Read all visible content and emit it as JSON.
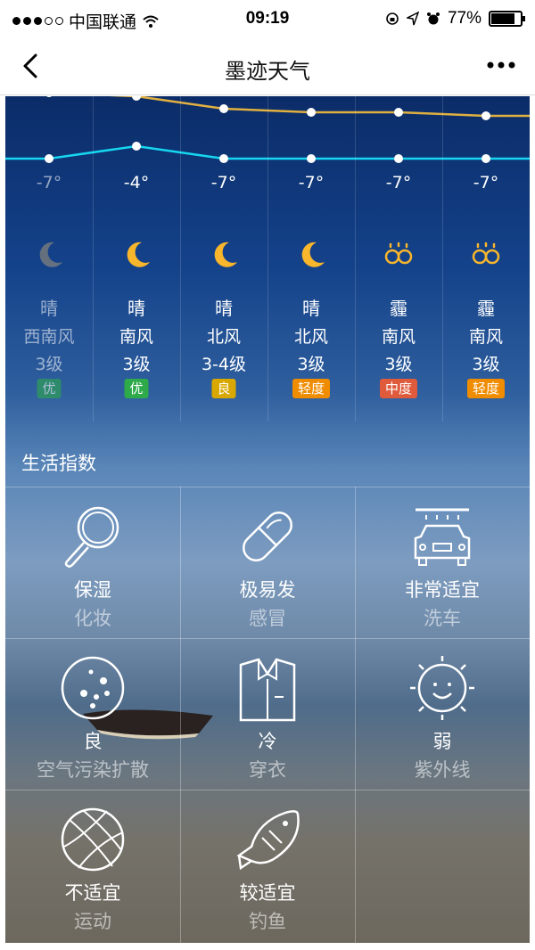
{
  "status_bar": {
    "carrier": "中国联通",
    "time": "09:19",
    "battery": "77%",
    "signal_bars_filled": 3,
    "signal_bars_total": 5
  },
  "nav": {
    "title": "墨迹天气",
    "back_icon": "chevron-left-icon",
    "more_icon": "more-dots-icon"
  },
  "forecast": {
    "days": [
      {
        "low": "-7°",
        "cond": "晴",
        "wind": "西南风",
        "level": "3级",
        "aqi": "优",
        "aqi_color": "#2eaa4a",
        "icon": "moon-icon",
        "dim": true
      },
      {
        "low": "-4°",
        "cond": "晴",
        "wind": "南风",
        "level": "3级",
        "aqi": "优",
        "aqi_color": "#2eaa4a",
        "icon": "moon-icon",
        "dim": false
      },
      {
        "low": "-7°",
        "cond": "晴",
        "wind": "北风",
        "level": "3-4级",
        "aqi": "良",
        "aqi_color": "#d9a800",
        "icon": "moon-icon",
        "dim": false
      },
      {
        "low": "-7°",
        "cond": "晴",
        "wind": "北风",
        "level": "3级",
        "aqi": "轻度",
        "aqi_color": "#f08c00",
        "icon": "moon-icon",
        "dim": false
      },
      {
        "low": "-7°",
        "cond": "霾",
        "wind": "南风",
        "level": "3级",
        "aqi": "中度",
        "aqi_color": "#e05a3c",
        "icon": "haze-icon",
        "dim": false
      },
      {
        "low": "-7°",
        "cond": "霾",
        "wind": "南风",
        "level": "3级",
        "aqi": "轻度",
        "aqi_color": "#f08c00",
        "icon": "haze-icon",
        "dim": false
      }
    ],
    "line_colors": {
      "high": "#e0b040",
      "low": "#16d6f0"
    }
  },
  "life": {
    "title": "生活指数",
    "items": [
      {
        "value": "保湿",
        "label": "化妆",
        "icon": "magnifier-icon"
      },
      {
        "value": "极易发",
        "label": "感冒",
        "icon": "pill-icon"
      },
      {
        "value": "非常适宜",
        "label": "洗车",
        "icon": "car-wash-icon"
      },
      {
        "value": "良",
        "label": "空气污染扩散",
        "icon": "air-particles-icon"
      },
      {
        "value": "冷",
        "label": "穿衣",
        "icon": "shirt-icon"
      },
      {
        "value": "弱",
        "label": "紫外线",
        "icon": "sun-icon"
      },
      {
        "value": "不适宜",
        "label": "运动",
        "icon": "basketball-icon"
      },
      {
        "value": "较适宜",
        "label": "钓鱼",
        "icon": "fish-icon"
      }
    ]
  }
}
